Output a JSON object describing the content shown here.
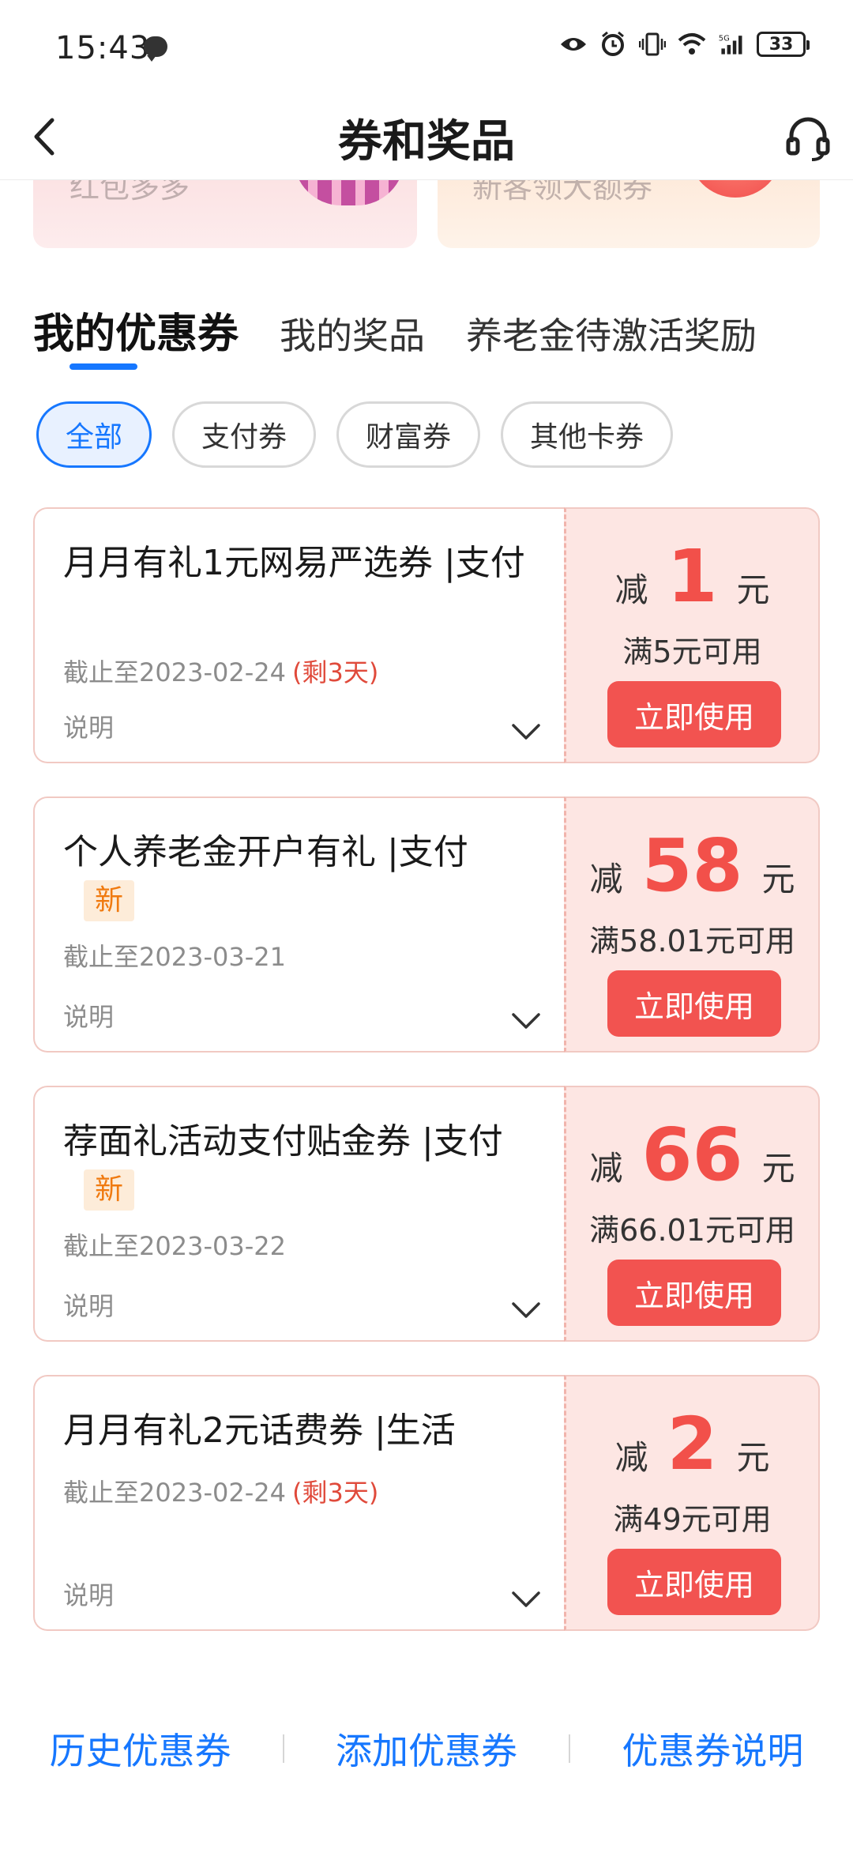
{
  "status_bar": {
    "time": "15:43",
    "battery": "33",
    "icons": [
      "chat-bubble-icon",
      "eye-icon",
      "alarm-icon",
      "vibrate-icon",
      "wifi-icon",
      "signal-5g-icon",
      "battery-icon"
    ]
  },
  "nav": {
    "title": "券和奖品",
    "back_icon": "chevron-left-icon",
    "service_icon": "headset-icon"
  },
  "banners": [
    {
      "text": "红包多多"
    },
    {
      "text": "新客领大额券"
    }
  ],
  "tabs": [
    {
      "label": "我的优惠券",
      "active": true
    },
    {
      "label": "我的奖品",
      "active": false
    },
    {
      "label": "养老金待激活奖励",
      "active": false
    }
  ],
  "filters": [
    {
      "label": "全部",
      "active": true
    },
    {
      "label": "支付券",
      "active": false
    },
    {
      "label": "财富券",
      "active": false
    },
    {
      "label": "其他卡券",
      "active": false
    }
  ],
  "coupons": [
    {
      "title": "月月有礼1元网易严选券 |支付",
      "is_new": false,
      "date": "截止至2023-02-24",
      "remain": "(剩3天)",
      "desc": "说明",
      "amount_prefix": "减",
      "amount": "1",
      "amount_unit": "元",
      "condition": "满5元可用",
      "button": "立即使用"
    },
    {
      "title": "个人养老金开户有礼 |支付",
      "is_new": true,
      "new_label": "新",
      "date": "截止至2023-03-21",
      "remain": "",
      "desc": "说明",
      "amount_prefix": "减",
      "amount": "58",
      "amount_unit": "元",
      "condition": "满58.01元可用",
      "button": "立即使用"
    },
    {
      "title": "荐面礼活动支付贴金券 |支付",
      "is_new": true,
      "new_label": "新",
      "date": "截止至2023-03-22",
      "remain": "",
      "desc": "说明",
      "amount_prefix": "减",
      "amount": "66",
      "amount_unit": "元",
      "condition": "满66.01元可用",
      "button": "立即使用"
    },
    {
      "title": "月月有礼2元话费券 |生活",
      "is_new": false,
      "date": "截止至2023-02-24",
      "remain": "(剩3天)",
      "desc": "说明",
      "amount_prefix": "减",
      "amount": "2",
      "amount_unit": "元",
      "condition": "满49元可用",
      "button": "立即使用"
    }
  ],
  "bottom_links": [
    {
      "label": "历史优惠券"
    },
    {
      "label": "添加优惠券"
    },
    {
      "label": "优惠券说明"
    }
  ],
  "colors": {
    "accent": "#1677ff",
    "red": "#f25350",
    "coupon_bg": "#fde6e3",
    "new_badge": "#f07a10"
  }
}
